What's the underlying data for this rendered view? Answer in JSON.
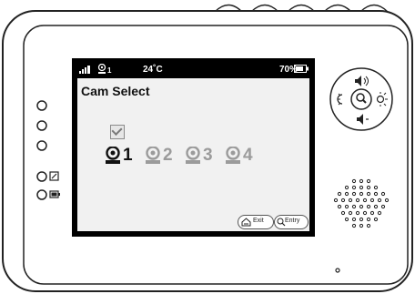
{
  "status": {
    "channel": "1",
    "temperature": "24˚C",
    "battery": "70%"
  },
  "menu": {
    "title": "Cam Select",
    "cameras": [
      {
        "number": "1",
        "selected": true
      },
      {
        "number": "2",
        "selected": false
      },
      {
        "number": "3",
        "selected": false
      },
      {
        "number": "4",
        "selected": false
      }
    ]
  },
  "hints": {
    "exit": "Exit",
    "entry": "Entry"
  },
  "colors": {
    "bezel": "#ffffff",
    "screen_frame": "#000000",
    "menu_background": "#f1f1f1",
    "inactive_camera": "#9b9b9b"
  }
}
